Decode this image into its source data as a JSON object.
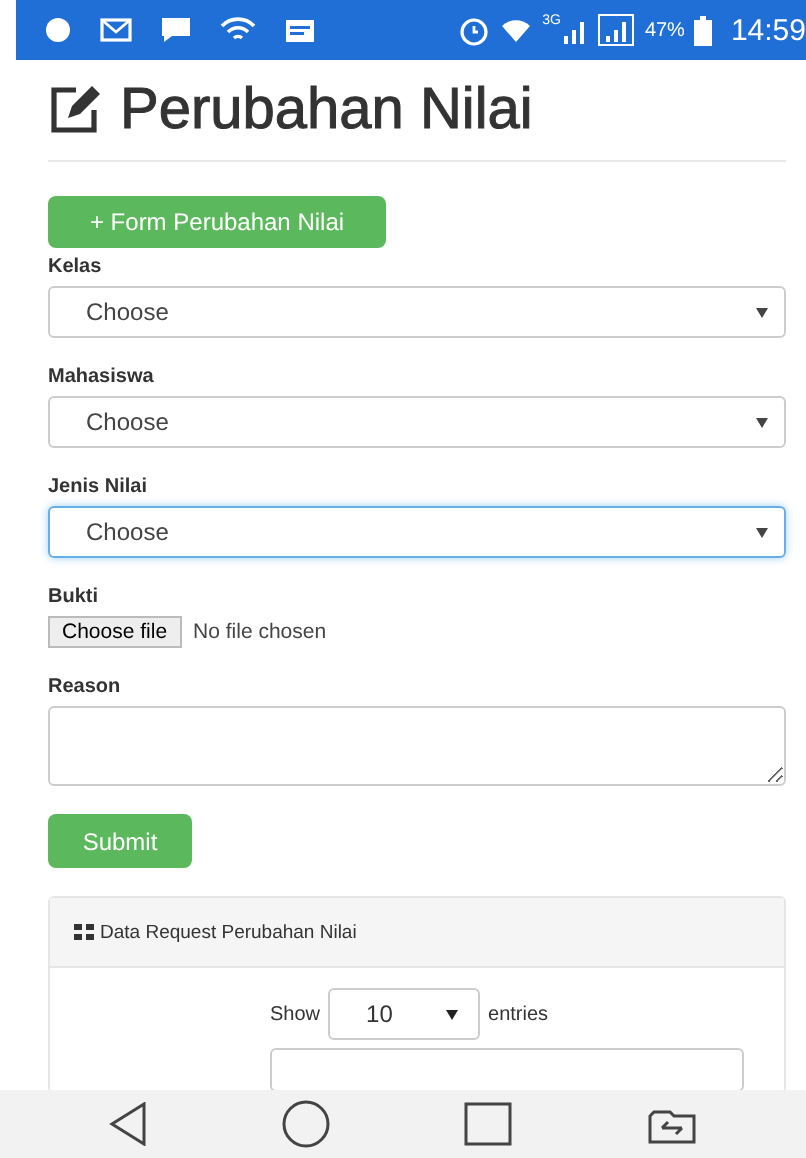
{
  "status_bar": {
    "network": "3G",
    "battery": "47%",
    "time": "14:59"
  },
  "page": {
    "title": "Perubahan Nilai",
    "add_button": "+ Form Perubahan Nilai"
  },
  "form": {
    "fields": [
      {
        "kind": "select",
        "label": "Kelas",
        "value": "Choose",
        "focused": false
      },
      {
        "kind": "select",
        "label": "Mahasiswa",
        "value": "Choose",
        "focused": false
      },
      {
        "kind": "select",
        "label": "Jenis Nilai",
        "value": "Choose",
        "focused": true
      },
      {
        "kind": "file",
        "label": "Bukti",
        "button": "Choose file",
        "value": "No file chosen"
      },
      {
        "kind": "textarea",
        "label": "Reason"
      }
    ],
    "submit": "Submit"
  },
  "panel": {
    "title": "Data Request Perubahan Nilai",
    "show_label": "Show",
    "page_size": "10",
    "entries_label": "entries"
  }
}
